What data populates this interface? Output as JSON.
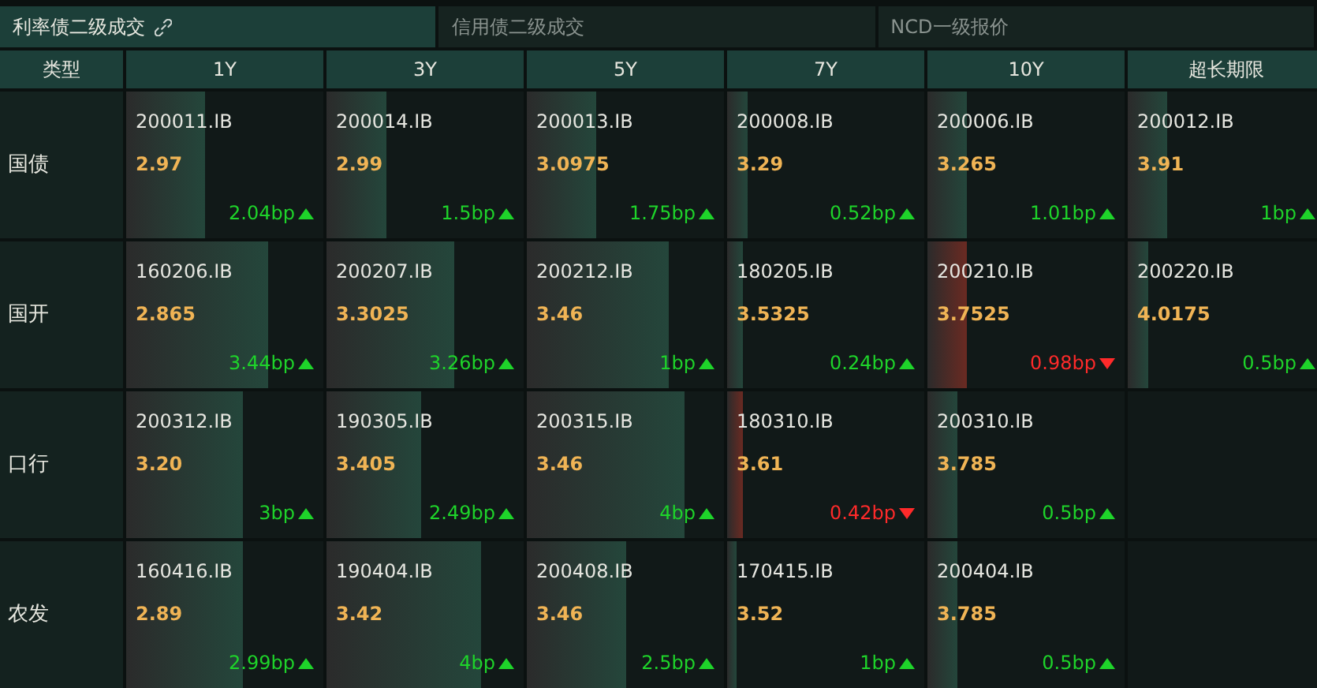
{
  "tabs": [
    {
      "label": "利率债二级成交",
      "selected": true,
      "linked": true
    },
    {
      "label": "信用债二级成交",
      "selected": false,
      "linked": false
    },
    {
      "label": "NCD一级报价",
      "selected": false,
      "linked": false
    }
  ],
  "table": {
    "columns": [
      "类型",
      "1Y",
      "3Y",
      "5Y",
      "7Y",
      "10Y",
      "超长期限"
    ],
    "rows": [
      [
        "国债",
        {
          "code": "200011.IB",
          "rate": "2.97",
          "change": "2.04bp",
          "kind": "up",
          "level": 0.4
        },
        {
          "code": "200014.IB",
          "rate": "2.99",
          "change": "1.5bp",
          "kind": "up",
          "level": 0.3
        },
        {
          "code": "200013.IB",
          "rate": "3.0975",
          "change": "1.75bp",
          "kind": "up",
          "level": 0.35
        },
        {
          "code": "200008.IB",
          "rate": "3.29",
          "change": "0.52bp",
          "kind": "up",
          "level": 0.1
        },
        {
          "code": "200006.IB",
          "rate": "3.265",
          "change": "1.01bp",
          "kind": "up",
          "level": 0.2
        },
        {
          "code": "200012.IB",
          "rate": "3.91",
          "change": "1bp",
          "kind": "up",
          "level": 0.2
        }
      ],
      [
        "国开",
        {
          "code": "160206.IB",
          "rate": "2.865",
          "change": "3.44bp",
          "kind": "up",
          "level": 0.72
        },
        {
          "code": "200207.IB",
          "rate": "3.3025",
          "change": "3.26bp",
          "kind": "up",
          "level": 0.65
        },
        {
          "code": "200212.IB",
          "rate": "3.46",
          "change": "1bp",
          "kind": "up",
          "level": 0.72
        },
        {
          "code": "180205.IB",
          "rate": "3.5325",
          "change": "0.24bp",
          "kind": "up",
          "level": 0.08
        },
        {
          "code": "200210.IB",
          "rate": "3.7525",
          "change": "0.98bp",
          "kind": "down",
          "level": 0.2
        },
        {
          "code": "200220.IB",
          "rate": "4.0175",
          "change": "0.5bp",
          "kind": "up",
          "level": 0.1
        }
      ],
      [
        "口行",
        {
          "code": "200312.IB",
          "rate": "3.20",
          "change": "3bp",
          "kind": "up",
          "level": 0.59
        },
        {
          "code": "190305.IB",
          "rate": "3.405",
          "change": "2.49bp",
          "kind": "up",
          "level": 0.48
        },
        {
          "code": "200315.IB",
          "rate": "3.46",
          "change": "4bp",
          "kind": "up",
          "level": 0.8
        },
        {
          "code": "180310.IB",
          "rate": "3.61",
          "change": "0.42bp",
          "kind": "down",
          "level": 0.08
        },
        {
          "code": "200310.IB",
          "rate": "3.785",
          "change": "0.5bp",
          "kind": "up",
          "level": 0.15
        },
        ""
      ],
      [
        "农发",
        {
          "code": "160416.IB",
          "rate": "2.89",
          "change": "2.99bp",
          "kind": "up",
          "level": 0.59
        },
        {
          "code": "190404.IB",
          "rate": "3.42",
          "change": "4bp",
          "kind": "up",
          "level": 0.78
        },
        {
          "code": "200408.IB",
          "rate": "3.46",
          "change": "2.5bp",
          "kind": "up",
          "level": 0.5
        },
        {
          "code": "170415.IB",
          "rate": "3.52",
          "change": "1bp",
          "kind": "up",
          "level": 0.05
        },
        {
          "code": "200404.IB",
          "rate": "3.785",
          "change": "0.5bp",
          "kind": "up",
          "level": 0.15
        },
        ""
      ]
    ]
  }
}
